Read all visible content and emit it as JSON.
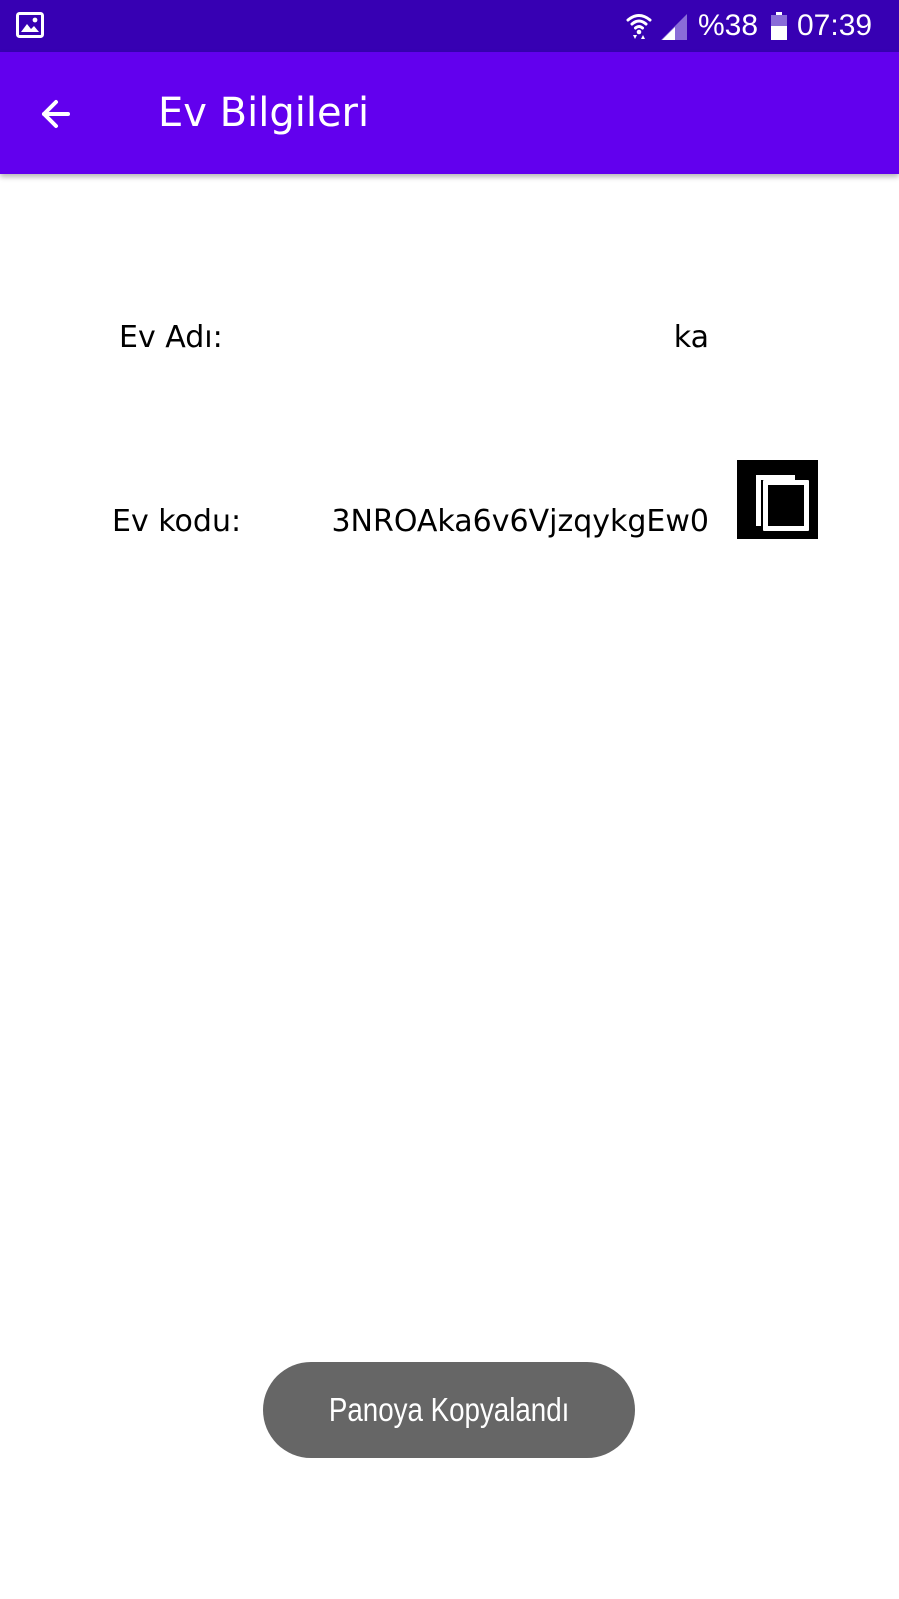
{
  "status_bar": {
    "battery_text": "%38",
    "time": "07:39",
    "icons": [
      "gallery-icon",
      "wifi-icon",
      "signal-icon",
      "battery-icon"
    ]
  },
  "app_bar": {
    "title": "Ev Bilgileri",
    "back_icon": "arrow-back-icon",
    "color": "#6200ee"
  },
  "home_info": {
    "name_label": "Ev Adı:",
    "name_value": "ka",
    "code_label": "Ev kodu:",
    "code_value": "3NROAka6v6VjzqykgEw0",
    "copy_icon": "copy-icon"
  },
  "toast": {
    "message": "Panoya Kopyalandı"
  },
  "colors": {
    "status_bar": "#3700b3",
    "app_bar": "#6200ee",
    "toast": "#666666"
  }
}
